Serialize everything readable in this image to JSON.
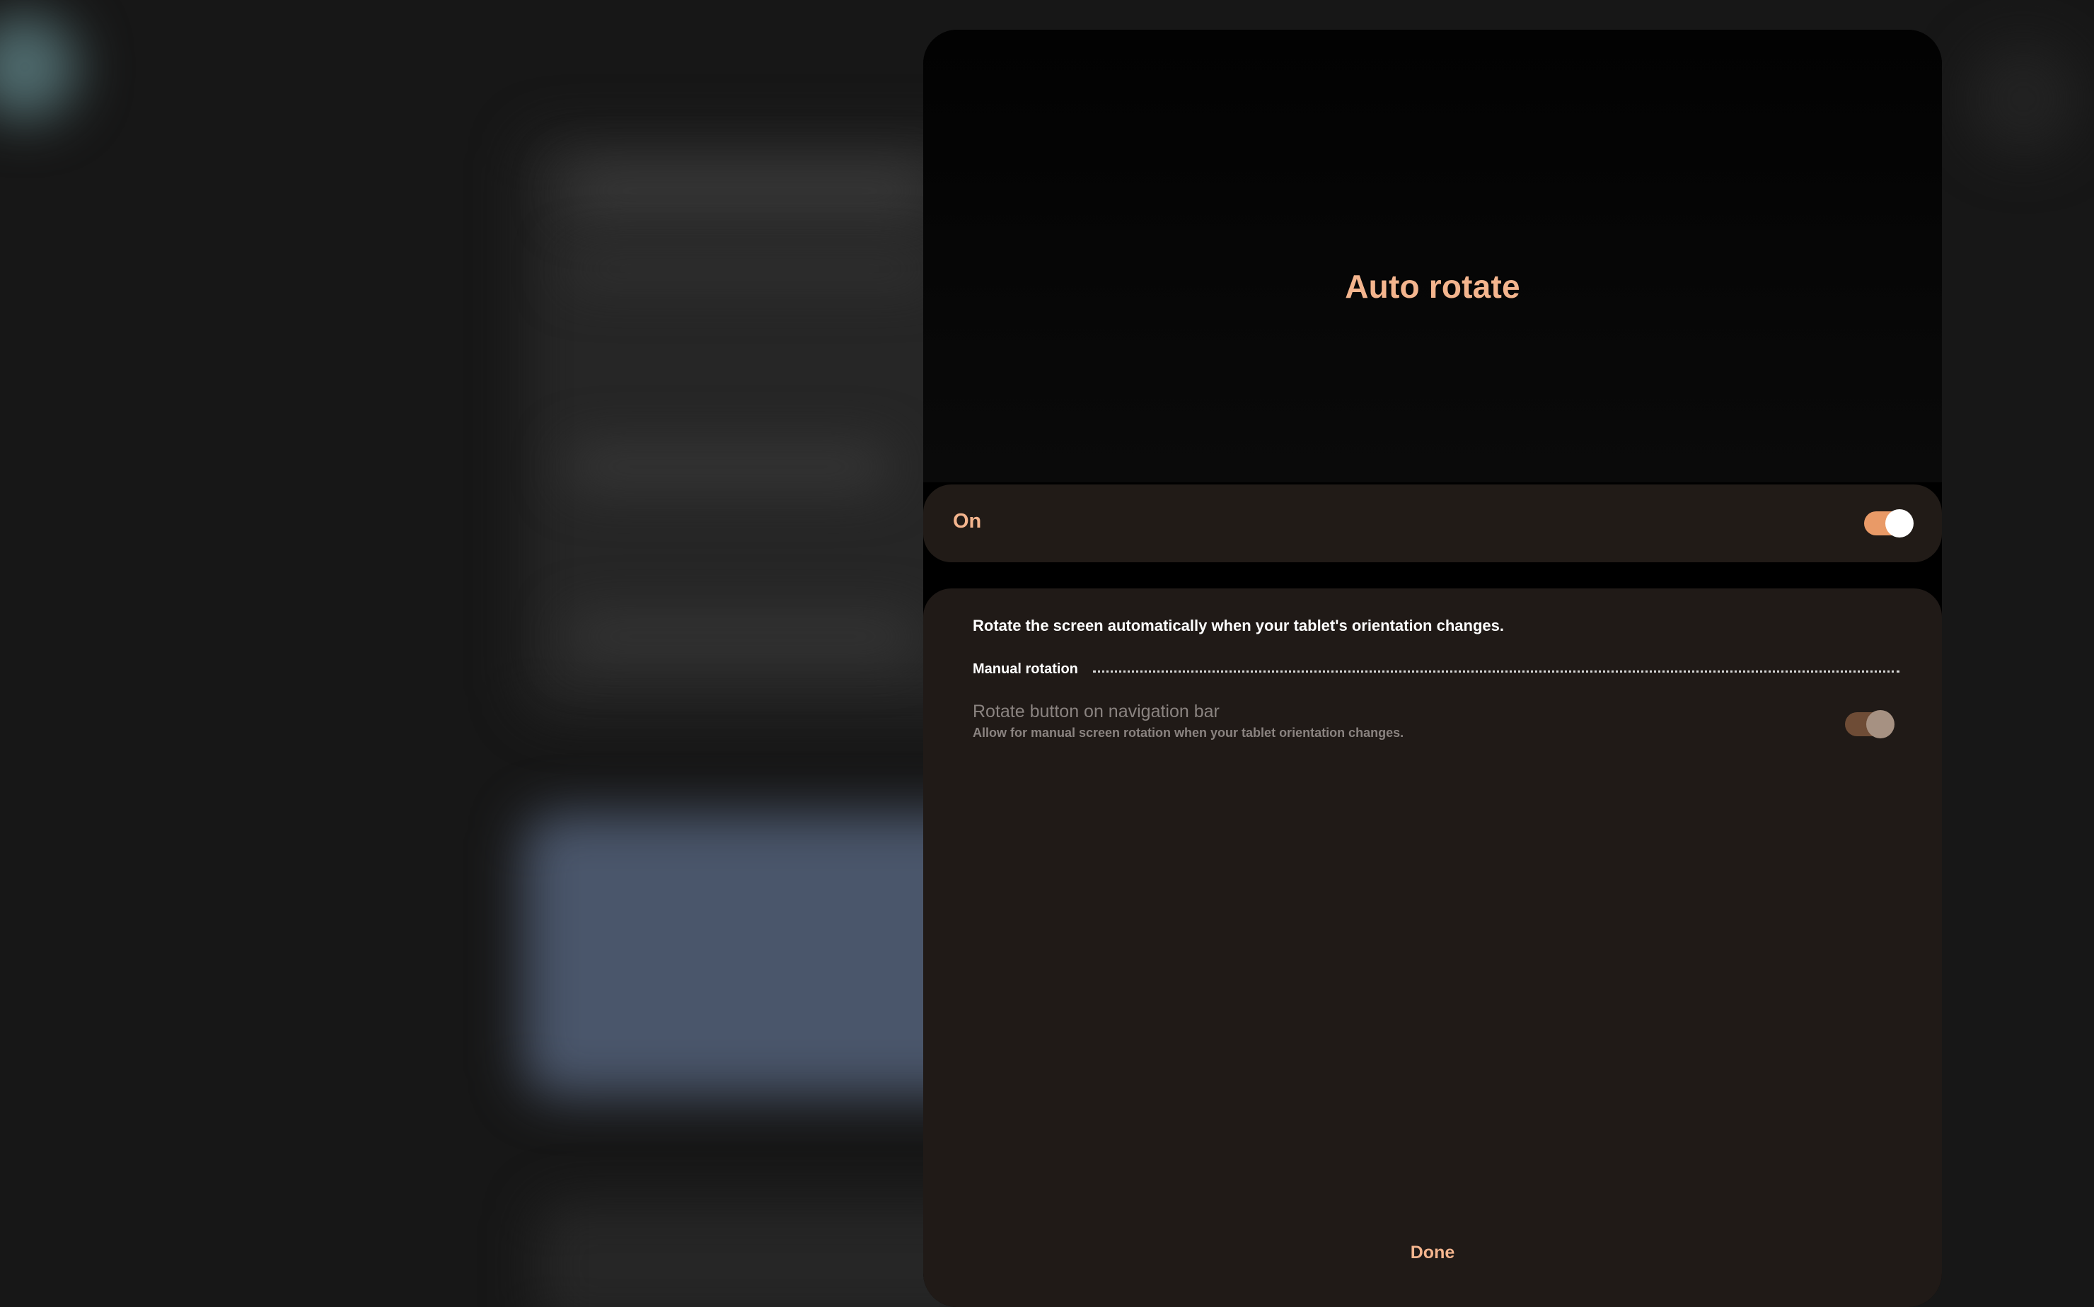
{
  "dialog": {
    "title": "Auto rotate",
    "master_switch": {
      "label": "On",
      "state": "on"
    },
    "description": "Rotate the screen automatically when your tablet's orientation changes.",
    "section": {
      "title": "Manual rotation",
      "items": [
        {
          "title": "Rotate button on navigation bar",
          "subtitle": "Allow for manual screen rotation when your tablet orientation changes.",
          "state": "on (disabled)"
        }
      ]
    },
    "done_label": "Done"
  },
  "colors": {
    "accent": "#f4b58e",
    "switch_on_track": "#e99a67",
    "card_background": "#211b17",
    "dialog_background": "#000000",
    "disabled_text": "#8a8380"
  }
}
